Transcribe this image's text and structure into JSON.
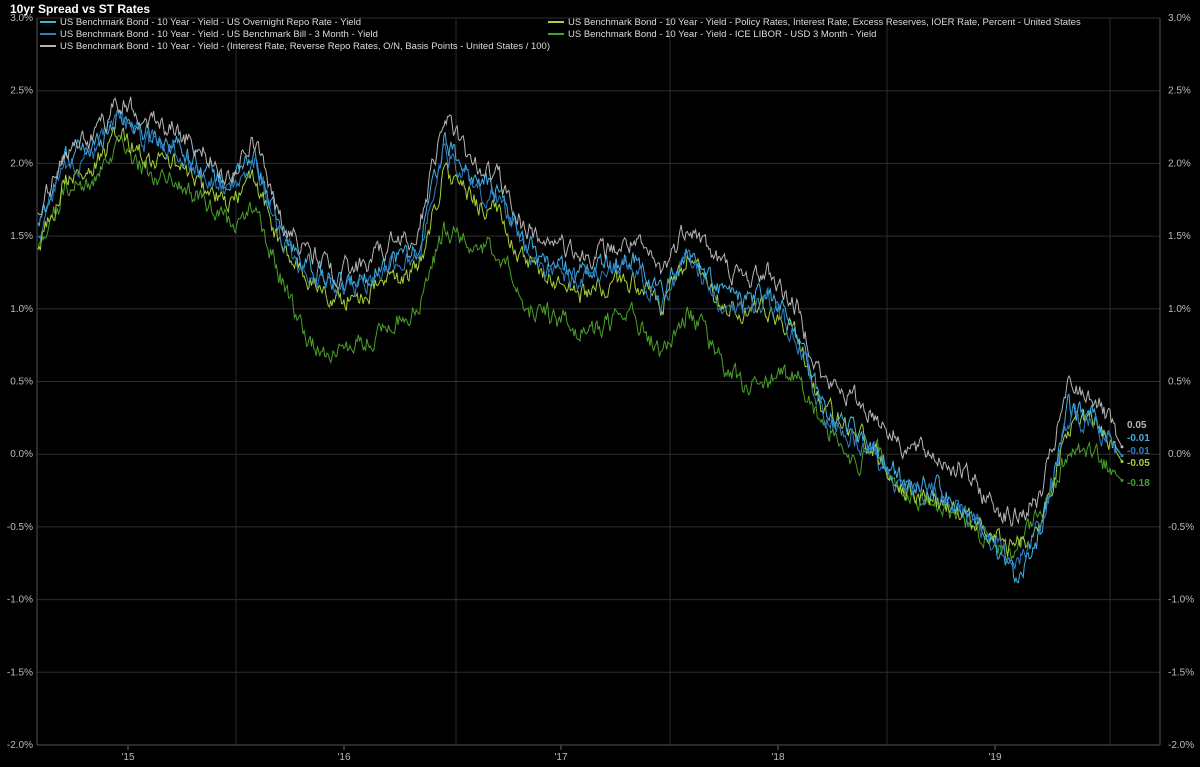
{
  "chart_data": {
    "type": "line",
    "title": "10yr Spread vs ST Rates",
    "ylim": [
      -2.0,
      3.0
    ],
    "y_ticks": [
      "3.0%",
      "2.5%",
      "2.0%",
      "1.5%",
      "1.0%",
      "0.5%",
      "0.0%",
      "-0.5%",
      "-1.0%",
      "-1.5%",
      "-2.0%"
    ],
    "x_ticks": [
      "'15",
      "'16",
      "'17",
      "'18",
      "'19"
    ],
    "grid": true,
    "legend_placement": "top",
    "x": [
      "2014-08",
      "2014-10",
      "2014-12",
      "2015-02",
      "2015-04",
      "2015-06",
      "2015-08",
      "2015-10",
      "2015-12",
      "2016-02",
      "2016-04",
      "2016-06",
      "2016-08",
      "2016-10",
      "2016-12",
      "2017-02",
      "2017-04",
      "2017-06",
      "2017-08",
      "2017-10",
      "2017-12",
      "2018-02",
      "2018-04",
      "2018-06",
      "2018-08",
      "2018-10",
      "2018-12",
      "2019-02",
      "2019-04",
      "2019-06",
      "2019-08",
      "2019-10",
      "2019-12",
      "2020-02",
      "2020-03"
    ],
    "series": [
      {
        "name": "US Benchmark Bond - 10 Year - Yield - US Overnight Repo Rate - Yield",
        "color": "#3fb0e6",
        "last_label": "-0.01",
        "values": [
          1.55,
          2.05,
          2.1,
          2.35,
          2.2,
          2.15,
          2.0,
          1.85,
          2.05,
          1.5,
          1.3,
          1.15,
          1.2,
          1.35,
          1.4,
          2.15,
          1.9,
          1.8,
          1.45,
          1.3,
          1.25,
          1.3,
          1.35,
          1.1,
          1.4,
          1.15,
          1.05,
          1.1,
          0.85,
          0.3,
          0.2,
          0.0,
          -0.2,
          -0.2,
          -0.35,
          -0.6,
          -0.85,
          -0.55,
          0.3,
          0.25,
          -0.01
        ]
      },
      {
        "name": "US Benchmark Bond - 10 Year - Yield - US Benchmark Bill - 3 Month - Yield",
        "color": "#2f7fbf",
        "last_label": "-0.01",
        "values": [
          1.5,
          2.0,
          2.05,
          2.3,
          2.15,
          2.1,
          1.95,
          1.8,
          2.0,
          1.45,
          1.25,
          1.1,
          1.15,
          1.3,
          1.35,
          2.1,
          1.85,
          1.75,
          1.4,
          1.25,
          1.2,
          1.25,
          1.3,
          1.05,
          1.35,
          1.1,
          1.0,
          1.05,
          0.8,
          0.25,
          0.15,
          -0.05,
          -0.25,
          -0.25,
          -0.4,
          -0.55,
          -0.75,
          -0.5,
          0.25,
          0.2,
          -0.01
        ]
      },
      {
        "name": "US Benchmark Bond - 10 Year - Yield - (Interest Rate, Reverse Repo Rates, O/N, Basis Points - United States / 100)",
        "color": "#b5b5b5",
        "last_label": "0.05",
        "values": [
          1.6,
          2.1,
          2.15,
          2.45,
          2.3,
          2.25,
          2.1,
          1.9,
          2.15,
          1.6,
          1.4,
          1.25,
          1.3,
          1.45,
          1.5,
          2.35,
          2.0,
          1.9,
          1.55,
          1.45,
          1.35,
          1.4,
          1.45,
          1.25,
          1.6,
          1.35,
          1.2,
          1.25,
          1.0,
          0.5,
          0.4,
          0.25,
          0.05,
          0.0,
          -0.1,
          -0.3,
          -0.45,
          -0.3,
          0.45,
          0.4,
          0.05
        ]
      },
      {
        "name": "US Benchmark Bond - 10 Year - Yield - Policy Rates, Interest Rate, Excess Reserves, IOER Rate, Percent - United States",
        "color": "#a6d13a",
        "last_label": "-0.05",
        "values": [
          1.4,
          1.9,
          1.95,
          2.2,
          2.05,
          2.0,
          1.85,
          1.7,
          1.9,
          1.4,
          1.2,
          1.05,
          1.1,
          1.2,
          1.25,
          1.95,
          1.75,
          1.65,
          1.3,
          1.2,
          1.1,
          1.15,
          1.2,
          1.0,
          1.35,
          1.05,
          0.95,
          1.0,
          0.8,
          0.3,
          0.2,
          0.0,
          -0.25,
          -0.3,
          -0.4,
          -0.5,
          -0.65,
          -0.5,
          0.2,
          0.25,
          -0.05
        ]
      },
      {
        "name": "US Benchmark Bond - 10 Year - Yield - ICE LIBOR - USD 3 Month - Yield",
        "color": "#4a9e2a",
        "last_label": "-0.18",
        "values": [
          1.45,
          1.8,
          1.85,
          2.1,
          1.95,
          1.9,
          1.75,
          1.6,
          1.7,
          1.2,
          0.75,
          0.7,
          0.75,
          0.9,
          1.0,
          1.55,
          1.45,
          1.4,
          1.0,
          0.95,
          0.85,
          0.9,
          0.95,
          0.7,
          1.0,
          0.7,
          0.45,
          0.5,
          0.55,
          0.2,
          -0.05,
          0.0,
          -0.3,
          -0.35,
          -0.45,
          -0.55,
          -0.7,
          -0.4,
          0.0,
          0.0,
          -0.18
        ]
      }
    ]
  }
}
